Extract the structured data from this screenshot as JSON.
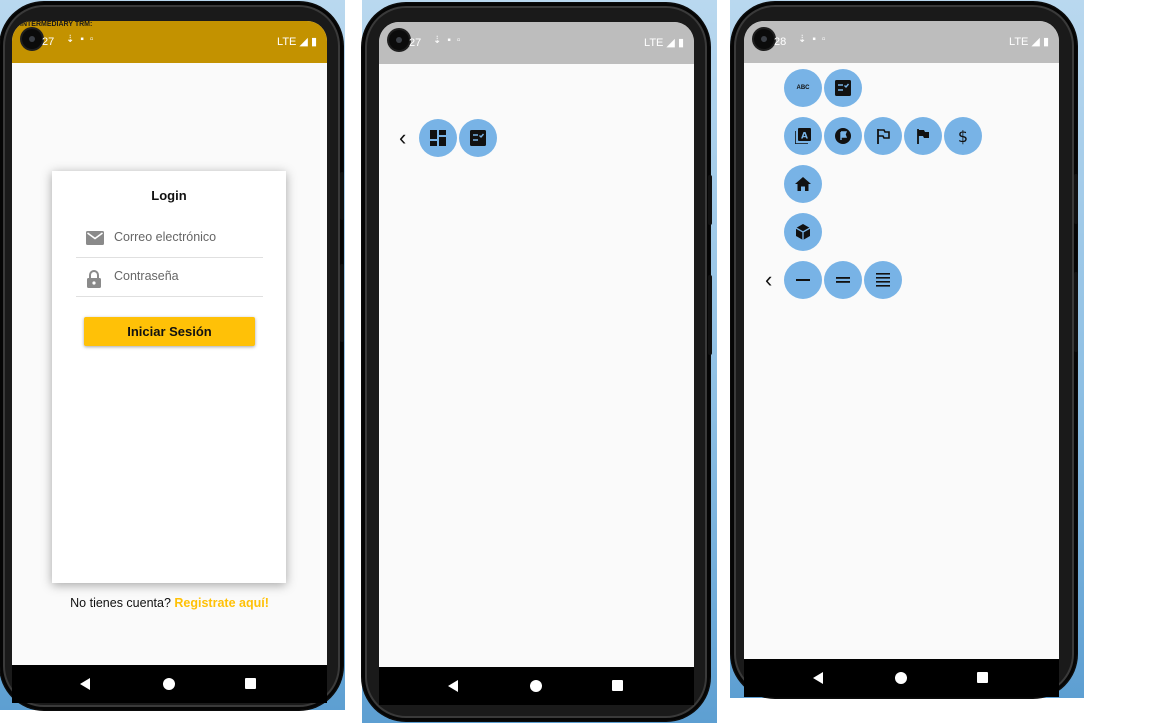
{
  "left_phone": {
    "banner": "INTERMEDIARY TRM:",
    "status": {
      "time": "27",
      "network": "LTE"
    },
    "login": {
      "title": "Login",
      "email_placeholder": "Correo electrónico",
      "password_placeholder": "Contraseña",
      "submit_label": "Iniciar Sesión"
    },
    "footer": {
      "prompt": "No tienes cuenta?",
      "link": "Registrate aquí!"
    }
  },
  "middle_phone": {
    "status": {
      "time": "27",
      "network": "LTE"
    },
    "buttons": [
      "dashboard-icon",
      "checklist-icon"
    ]
  },
  "right_phone": {
    "status": {
      "time": "28",
      "network": "LTE"
    },
    "rows": [
      [
        "abc-icon",
        "checklist-icon"
      ],
      [
        "font-library-icon",
        "play-flag-icon",
        "outlined-flag-icon",
        "filled-flag-icon",
        "dollar-icon"
      ],
      [
        "home-icon"
      ],
      [
        "cube-icon"
      ],
      [
        "one-line-icon",
        "two-lines-icon",
        "four-lines-icon"
      ]
    ],
    "abc_text": "ABC"
  },
  "colors": {
    "accent_yellow": "#ffc107",
    "status_gold": "#c39200",
    "status_gray": "#bdbdbd",
    "fab_blue": "#78b3e6"
  }
}
